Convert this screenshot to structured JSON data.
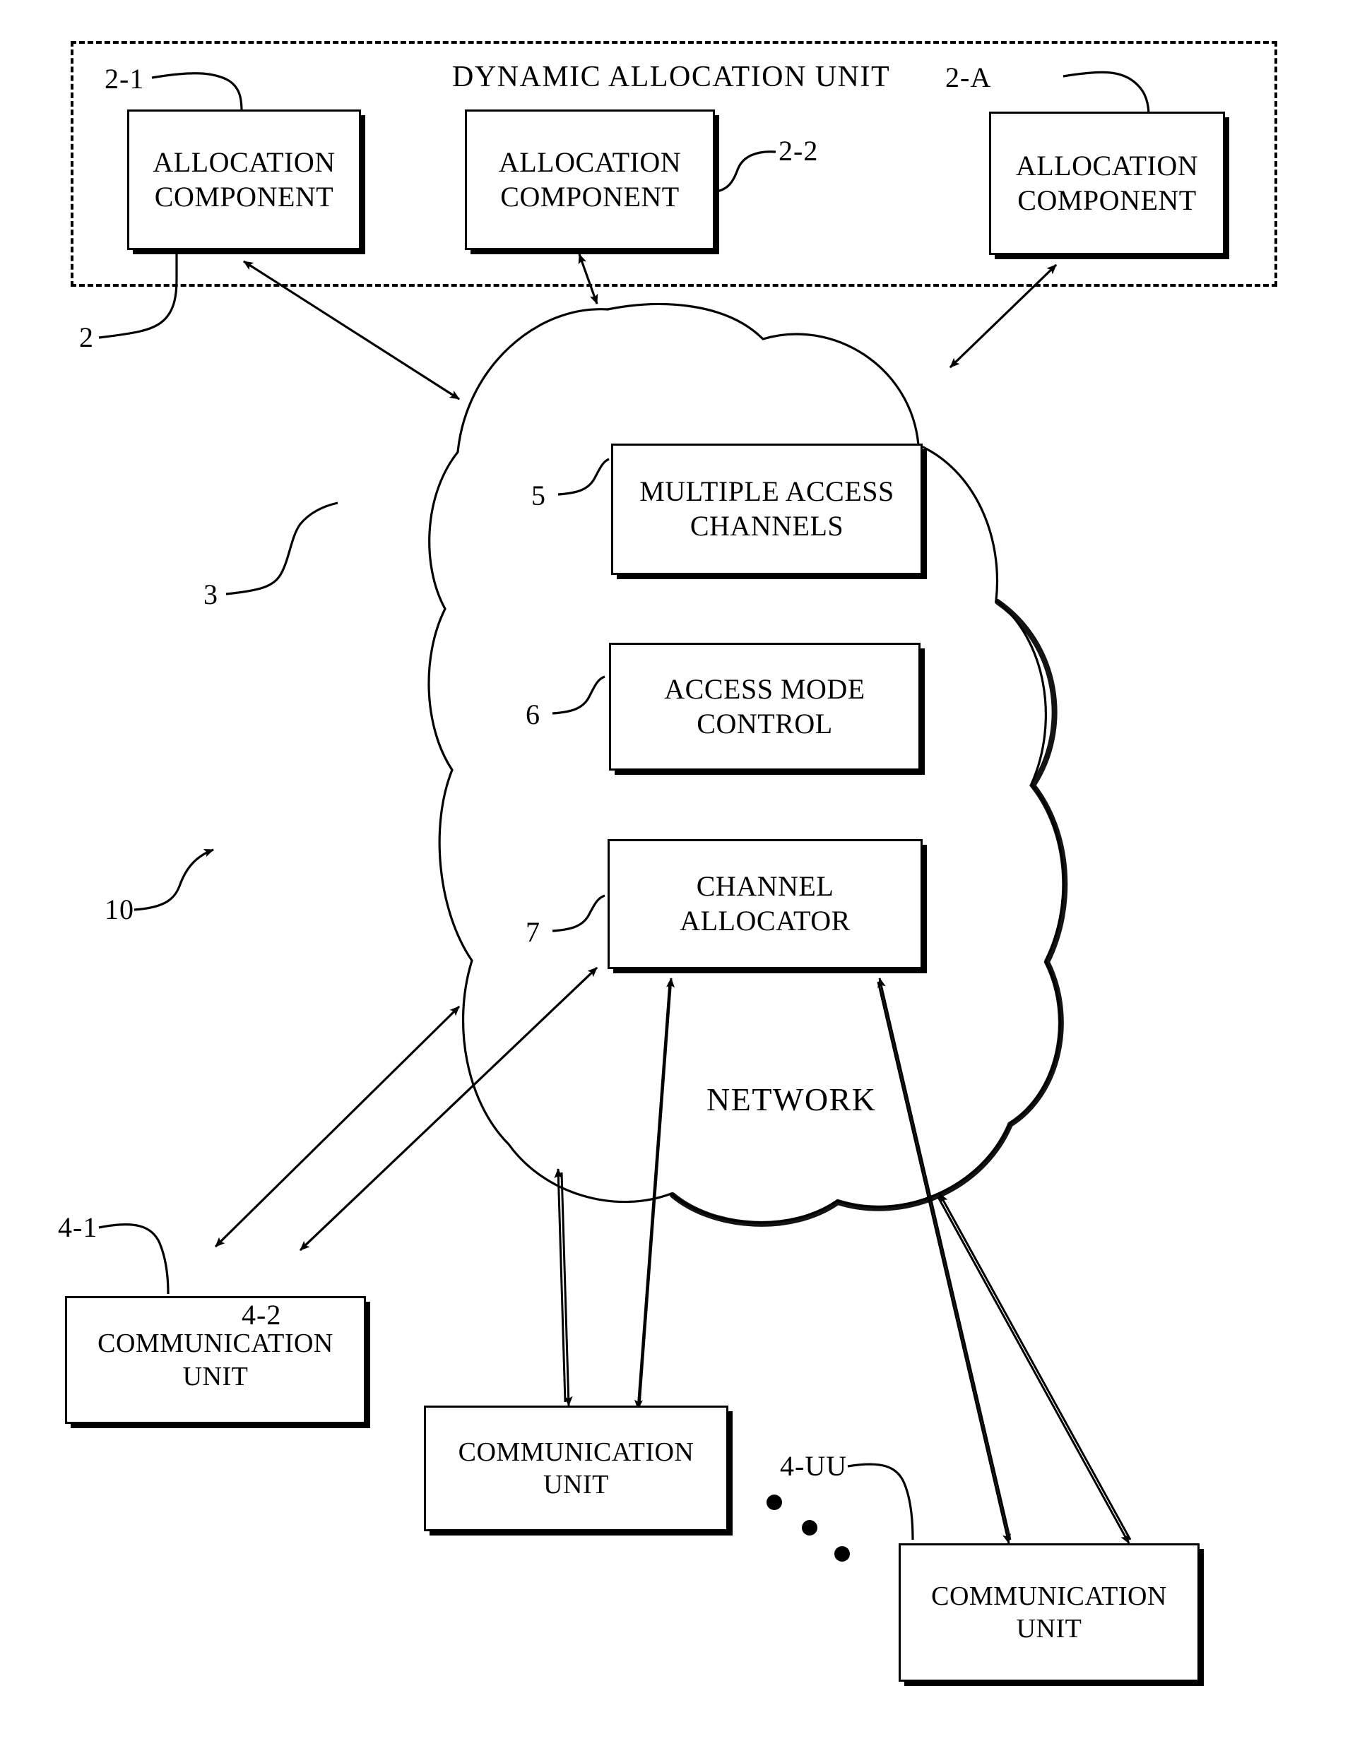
{
  "figure": {
    "title_label": "DYNAMIC ALLOCATION UNIT",
    "network_label": "NETWORK"
  },
  "dynamic_allocation_unit": {
    "label": "DYNAMIC ALLOCATION UNIT",
    "group_ref": "2",
    "components": [
      {
        "ref": "2-1",
        "label_line1": "ALLOCATION",
        "label_line2": "COMPONENT"
      },
      {
        "ref": "2-2",
        "label_line1": "ALLOCATION",
        "label_line2": "COMPONENT"
      },
      {
        "ref": "2-A",
        "label_line1": "ALLOCATION",
        "label_line2": "COMPONENT"
      }
    ]
  },
  "network": {
    "ref": "3",
    "label": "NETWORK",
    "blocks": [
      {
        "ref": "5",
        "label_line1": "MULTIPLE ACCESS",
        "label_line2": "CHANNELS"
      },
      {
        "ref": "6",
        "label_line1": "ACCESS MODE",
        "label_line2": "CONTROL"
      },
      {
        "ref": "7",
        "label_line1": "CHANNEL",
        "label_line2": "ALLOCATOR"
      }
    ]
  },
  "communication_units": [
    {
      "ref": "4-1",
      "label_line1": "COMMUNICATION",
      "label_line2": "UNIT"
    },
    {
      "ref": "4-2",
      "label_line1": "COMMUNICATION",
      "label_line2": "UNIT"
    },
    {
      "ref": "4-UU",
      "label_line1": "COMMUNICATION",
      "label_line2": "UNIT"
    }
  ],
  "system": {
    "ref": "10"
  },
  "colors": {
    "ink": "#000000",
    "paper": "#ffffff"
  }
}
